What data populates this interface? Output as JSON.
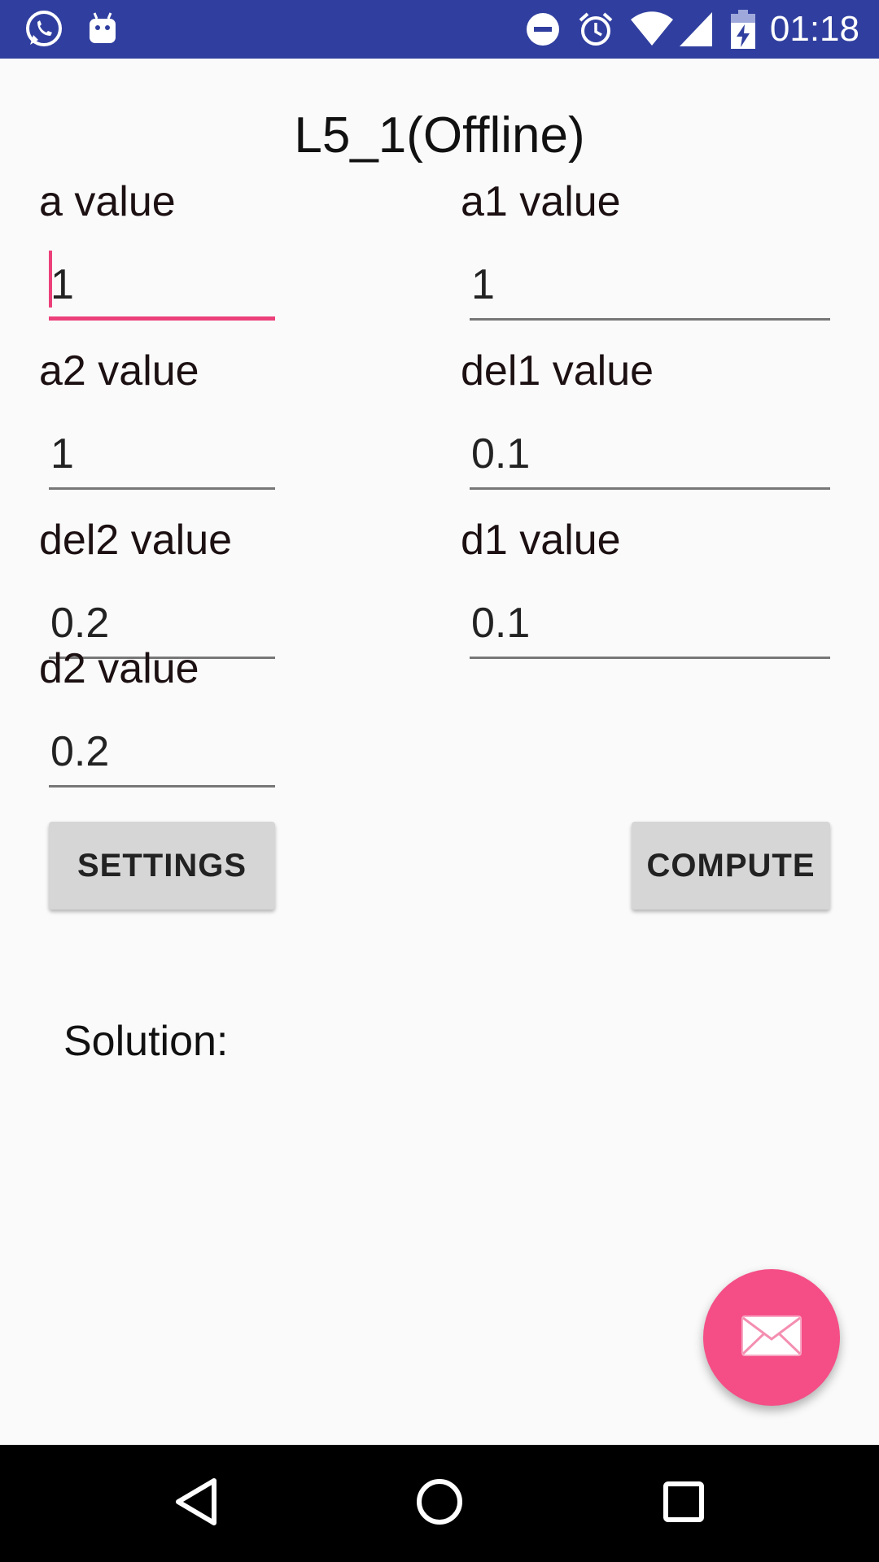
{
  "status_bar": {
    "time": "01:18",
    "icons": [
      "whatsapp-icon",
      "android-icon",
      "do-not-disturb-icon",
      "alarm-icon",
      "wifi-icon",
      "signal-icon",
      "battery-charging-icon"
    ],
    "color": "#303f9f"
  },
  "title": "L5_1(Offline)",
  "fields": {
    "a": {
      "label": "a value",
      "value": "1"
    },
    "a1": {
      "label": "a1 value",
      "value": "1"
    },
    "a2": {
      "label": "a2 value",
      "value": "1"
    },
    "del1": {
      "label": "del1 value",
      "value": "0.1"
    },
    "del2": {
      "label": "del2 value",
      "value": "0.2"
    },
    "d1": {
      "label": "d1 value",
      "value": "0.1"
    },
    "d2": {
      "label": "d2 value",
      "value": "0.2"
    }
  },
  "buttons": {
    "settings": "SETTINGS",
    "compute": "COMPUTE"
  },
  "solution_label": "Solution:",
  "fab": {
    "icon": "mail-icon",
    "color": "#f54e87"
  },
  "nav": {
    "icons": [
      "back-icon",
      "home-icon",
      "recents-icon"
    ]
  },
  "accent_color": "#ec407a"
}
